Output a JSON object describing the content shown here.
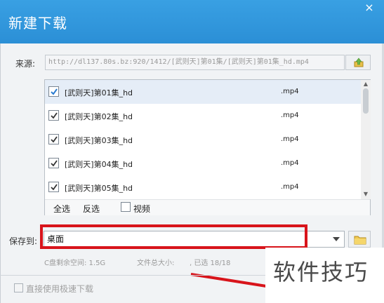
{
  "window": {
    "title": "新建下载",
    "close_glyph": "×"
  },
  "source": {
    "label": "来源:",
    "url": "http://dl137.80s.bz:920/1412/[武则天]第01集/[武则天]第01集_hd.mp4"
  },
  "file_list": {
    "items": [
      {
        "name": "[武则天]第01集_hd",
        "ext": ".mp4",
        "checked": true
      },
      {
        "name": "[武则天]第02集_hd",
        "ext": ".mp4",
        "checked": true
      },
      {
        "name": "[武则天]第03集_hd",
        "ext": ".mp4",
        "checked": true
      },
      {
        "name": "[武则天]第04集_hd",
        "ext": ".mp4",
        "checked": true
      },
      {
        "name": "[武则天]第05集_hd",
        "ext": ".mp4",
        "checked": true
      }
    ],
    "select_all": "全选",
    "invert": "反选",
    "video_label": "视频"
  },
  "save": {
    "label": "保存到:",
    "value": "桌面"
  },
  "status": {
    "disk_space": "C盘剩余空间: 1.5G",
    "total_size": "文件总大小: ",
    "selected_count": ", 已选 18/18"
  },
  "fast_download": {
    "label": "直接使用极速下载"
  },
  "watermark": {
    "text": "软件技巧"
  },
  "colors": {
    "titlebar": "#2b8fd6",
    "highlight": "#d8141b"
  }
}
